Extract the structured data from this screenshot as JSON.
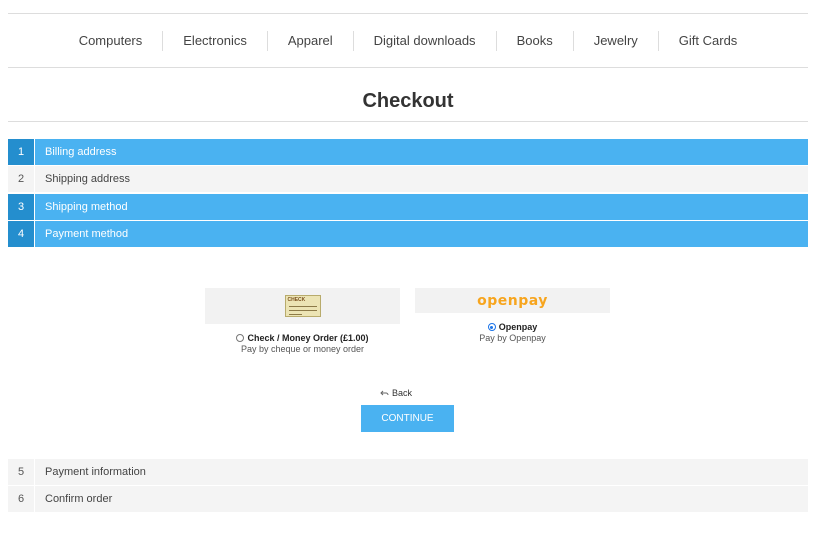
{
  "menu": [
    "Computers",
    "Electronics",
    "Apparel",
    "Digital downloads",
    "Books",
    "Jewelry",
    "Gift Cards"
  ],
  "page_title": "Checkout",
  "steps": [
    {
      "num": "1",
      "label": "Billing address"
    },
    {
      "num": "2",
      "label": "Shipping address"
    },
    {
      "num": "3",
      "label": "Shipping method"
    },
    {
      "num": "4",
      "label": "Payment method"
    },
    {
      "num": "5",
      "label": "Payment information"
    },
    {
      "num": "6",
      "label": "Confirm order"
    }
  ],
  "payment_methods": [
    {
      "name": "Check / Money Order (£1.00)",
      "description": "Pay by cheque or money order",
      "selected": false,
      "logo_text": "CHECK"
    },
    {
      "name": "Openpay",
      "description": "Pay by Openpay",
      "selected": true,
      "logo_text": "openpay"
    }
  ],
  "back_label": "Back",
  "continue_label": "CONTINUE",
  "colors": {
    "accent": "#4ab2f1",
    "accent_dark": "#248ece",
    "openpay_orange": "#f7a51e"
  }
}
